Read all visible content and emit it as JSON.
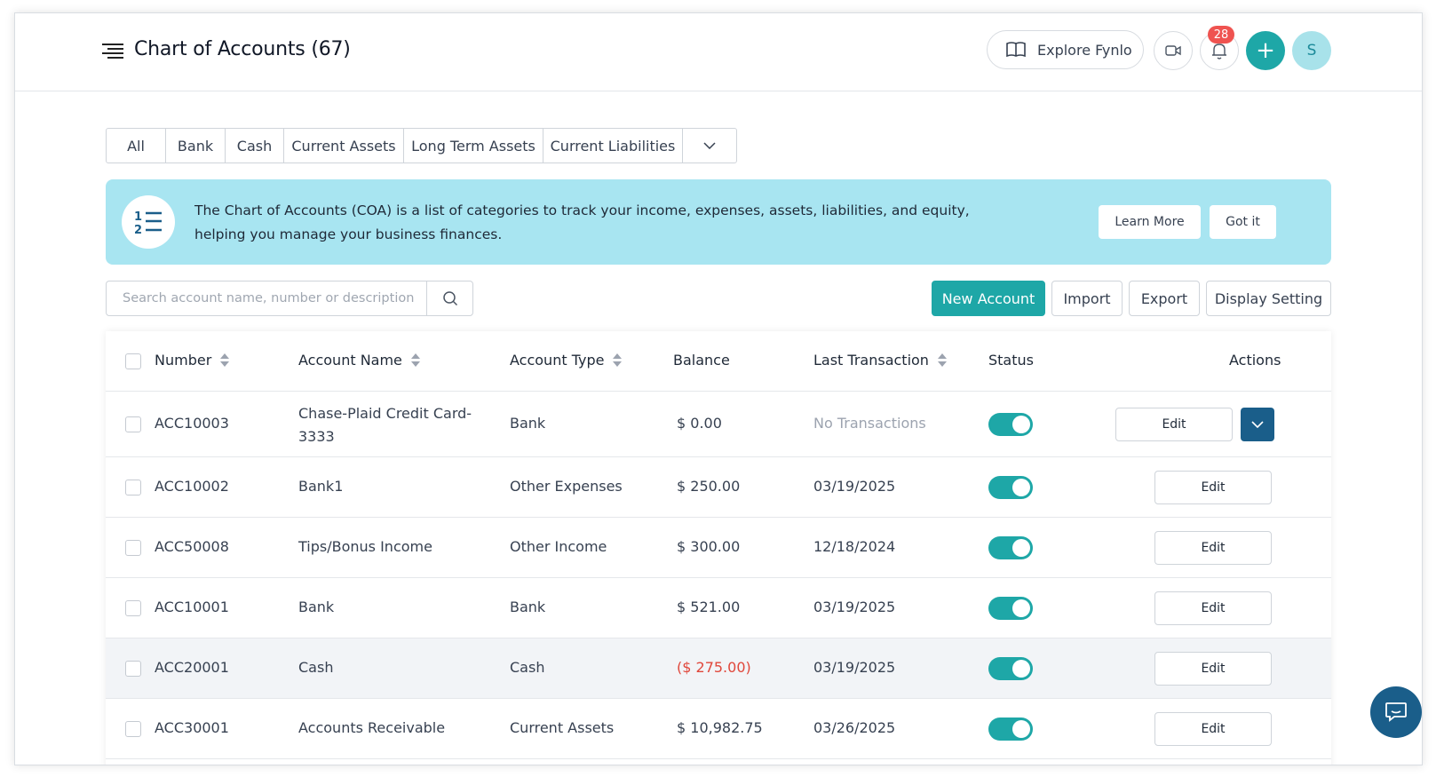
{
  "header": {
    "title": "Chart of Accounts (67)",
    "explore_label": "Explore Fynlo",
    "notification_count": "28",
    "avatar_initial": "S",
    "plus_label": "+"
  },
  "tabs": [
    "All",
    "Bank",
    "Cash",
    "Current Assets",
    "Long Term Assets",
    "Current Liabilities"
  ],
  "banner": {
    "text": "The Chart of Accounts (COA) is a list of categories to track your income, expenses, assets, liabilities, and equity, helping you manage your business finances.",
    "learn_more": "Learn More",
    "got_it": "Got it"
  },
  "search": {
    "placeholder": "Search account name, number or description",
    "value": ""
  },
  "toolbar": {
    "new_account": "New Account",
    "import": "Import",
    "export": "Export",
    "display_setting": "Display Setting"
  },
  "table": {
    "columns": {
      "number": "Number",
      "account_name": "Account Name",
      "account_type": "Account Type",
      "balance": "Balance",
      "last_transaction": "Last Transaction",
      "status": "Status",
      "actions": "Actions"
    },
    "edit_label": "Edit",
    "rows": [
      {
        "number": "ACC10003",
        "name": "Chase-Plaid Credit Card-3333",
        "type": "Bank",
        "balance": "$ 0.00",
        "last": "No Transactions",
        "status": "on"
      },
      {
        "number": "ACC10002",
        "name": "Bank1",
        "type": "Other Expenses",
        "balance": "$ 250.00",
        "last": "03/19/2025",
        "status": "on"
      },
      {
        "number": "ACC50008",
        "name": "Tips/Bonus Income",
        "type": "Other Income",
        "balance": "$ 300.00",
        "last": "12/18/2024",
        "status": "on"
      },
      {
        "number": "ACC10001",
        "name": "Bank",
        "type": "Bank",
        "balance": "$ 521.00",
        "last": "03/19/2025",
        "status": "on"
      },
      {
        "number": "ACC20001",
        "name": "Cash",
        "type": "Cash",
        "balance": "($ 275.00)",
        "last": "03/19/2025",
        "status": "on"
      },
      {
        "number": "ACC30001",
        "name": "Accounts Receivable",
        "type": "Current Assets",
        "balance": "$ 10,982.75",
        "last": "03/26/2025",
        "status": "on"
      }
    ]
  },
  "colors": {
    "accent": "#1ea7a7",
    "banner_bg": "#a8e5f1",
    "dark_blue": "#1a5e8a",
    "negative": "#e0473b",
    "badge": "#ef5350"
  },
  "icons": {
    "menu": "menu-icon",
    "book": "book-icon",
    "video": "video-icon",
    "bell": "bell-icon",
    "search": "search-icon",
    "chevron": "chevron-down-icon",
    "list": "numbered-list-icon",
    "chat": "chat-icon"
  }
}
